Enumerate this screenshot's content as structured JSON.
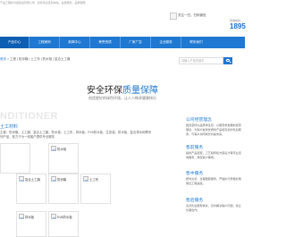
{
  "topbar": {
    "text": "产品工程料方案建设有限公司 · 您好欢迎来到本站，品质服务，品质保障"
  },
  "header": {
    "qr_text": "关注一扫，扫码微信",
    "phone_label": "咨询热线",
    "phone_number": "1895"
  },
  "nav": {
    "items": [
      {
        "label": "产品中心"
      },
      {
        "label": "工程案例"
      },
      {
        "label": "新闻中心"
      },
      {
        "label": "荣誉资质"
      },
      {
        "label": "厂家广告"
      },
      {
        "label": "企业服务"
      },
      {
        "label": "联系我们"
      }
    ]
  },
  "breadcrumb": {
    "home": "首页",
    "sep1": "工程",
    "sep2": "防渗膜",
    "sep3": "土工布",
    "sep4": "防水毯",
    "sep5": "复合土工膜"
  },
  "search": {
    "placeholder": "请输入产品关键字"
  },
  "banner": {
    "title_main": "安全环保",
    "title_highlight": "质量保障",
    "subtitle": "创造更好的绿色环境，让人人畅享健康快乐"
  },
  "watermark": "NDITIONER",
  "section": {
    "title": "土工材料",
    "desc": "主营：防渗膜，土工膜，复合土工膜，防水毯，土工布，排水板，EVA防水板，生态袋，防水板，复合排水网等系列产品，致力于为一线客户提供专业服务"
  },
  "products": [
    {
      "label": "防水毯"
    },
    {
      "label": "复合土工膜"
    },
    {
      "label": "防渗膜"
    },
    {
      "label": "土工布"
    },
    {
      "label": "排水板"
    },
    {
      "label": "EVA防水板"
    }
  ],
  "sidebar": [
    {
      "heading": "公司经营理念",
      "text": "始终坚持以品质求生存、以服务求发展的经营理念，为客户提供优质的产品和完善的售后服务，与客户共同成长共赢未来。"
    },
    {
      "heading": "售前服务",
      "text": "提供产品选型，工艺指导和方案设计等专业咨询服务，满足客户需求。"
    },
    {
      "heading": "售中服务",
      "text": "按时交货，全程跟踪服务，严格执行质量标准保证工程进度。"
    },
    {
      "heading": "售后服务",
      "text": "完善售后服务体系，及时解决客户问题，建立长期合作。"
    }
  ]
}
